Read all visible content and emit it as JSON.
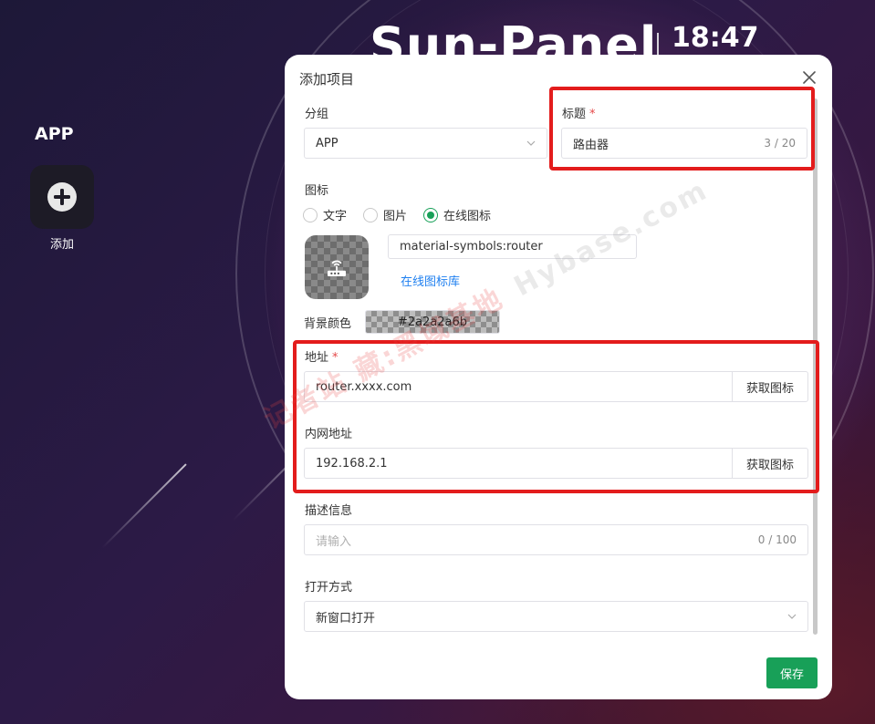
{
  "header": {
    "brand": "Sun-Panel",
    "clock": "18:47"
  },
  "sidebar": {
    "group_title": "APP",
    "add_label": "添加"
  },
  "modal": {
    "title": "添加项目",
    "group": {
      "label": "分组",
      "value": "APP"
    },
    "title_field": {
      "label": "标题",
      "required_mark": "*",
      "value": "路由器",
      "count": "3 / 20"
    },
    "icon": {
      "label": "图标",
      "options": [
        "文字",
        "图片",
        "在线图标"
      ],
      "selected": "在线图标",
      "icon_name": "material-symbols:router",
      "library_link": "在线图标库",
      "bg_label": "背景颜色",
      "bg_color": "#2a2a2a6b"
    },
    "url": {
      "label": "地址",
      "required_mark": "*",
      "value": "router.xxxx.com",
      "fetch_button": "获取图标"
    },
    "lan_url": {
      "label": "内网地址",
      "value": "192.168.2.1",
      "fetch_button": "获取图标"
    },
    "description": {
      "label": "描述信息",
      "placeholder": "请输入",
      "count": "0 / 100"
    },
    "open_method": {
      "label": "打开方式",
      "value": "新窗口打开"
    },
    "save_button": "保存"
  },
  "watermark": {
    "part1": "记者站 藏:黑域基地",
    "part2": "Hybase.com"
  },
  "colors": {
    "accent": "#18a058",
    "link": "#2080f0",
    "required": "#e54848",
    "highlight": "#e31c1c"
  }
}
